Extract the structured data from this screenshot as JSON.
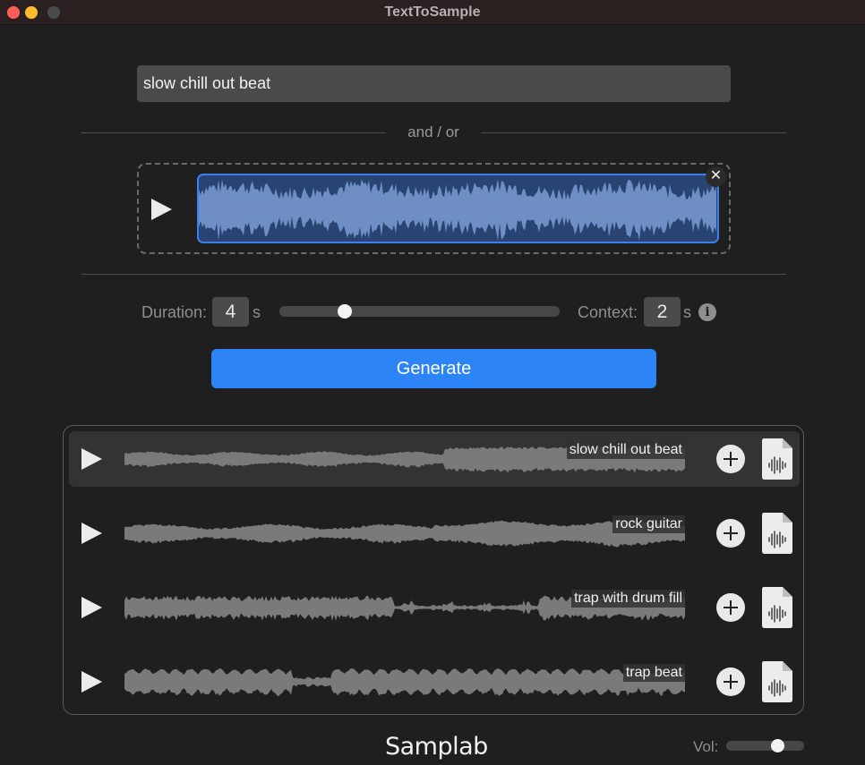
{
  "window": {
    "title": "TextToSample"
  },
  "prompt": {
    "value": "slow chill out beat",
    "placeholder": ""
  },
  "separator_text": "and / or",
  "reference_audio": {
    "loaded": true,
    "waveform_color": "#6f8fc4",
    "accent": "#3d7ef0"
  },
  "params": {
    "duration_label": "Duration:",
    "duration_value": "4",
    "duration_unit": "s",
    "duration_slider": {
      "min": 1,
      "max": 30,
      "value": 4
    },
    "context_label": "Context:",
    "context_value": "2",
    "context_unit": "s"
  },
  "generate": {
    "label": "Generate",
    "color": "#2c84f7"
  },
  "results": [
    {
      "label": "slow chill out beat",
      "selected": true,
      "style": "smooth"
    },
    {
      "label": "rock guitar",
      "selected": false,
      "style": "dense"
    },
    {
      "label": "trap with drum fill",
      "selected": false,
      "style": "spiky"
    },
    {
      "label": "trap beat",
      "selected": false,
      "style": "periodic"
    }
  ],
  "footer": {
    "brand": "Samplab",
    "volume_label": "Vol:",
    "volume": 0.7
  },
  "icons": {
    "play": "play-icon",
    "close": "close-icon",
    "info": "info-icon",
    "add": "plus-icon",
    "file": "audio-file-icon"
  }
}
